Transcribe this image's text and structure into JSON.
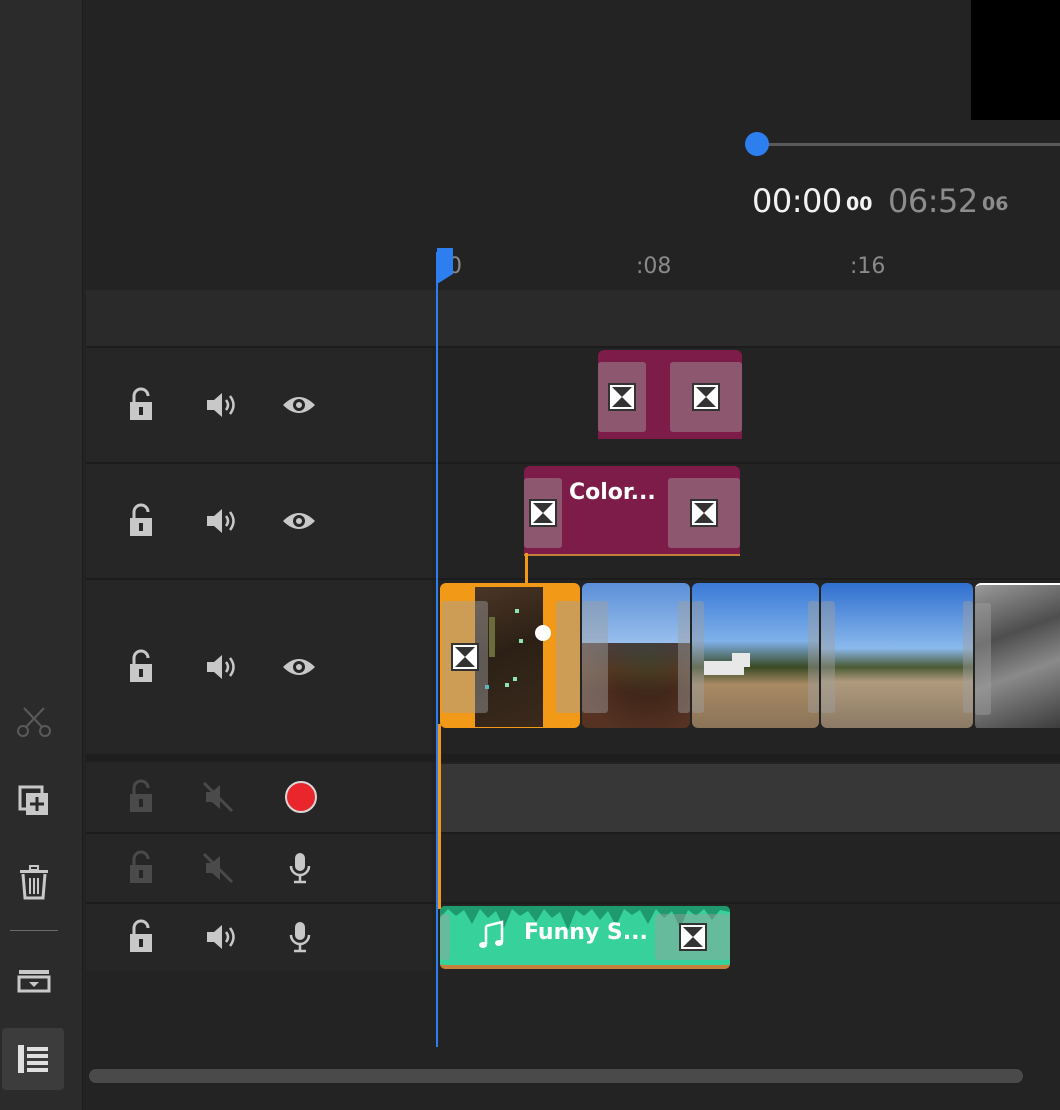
{
  "timecode": {
    "current": "00:00",
    "current_frames": "00",
    "duration": "06:52",
    "duration_frames": "06"
  },
  "ruler": {
    "labels": [
      "0",
      ":08",
      ":16"
    ]
  },
  "clips": {
    "title_clip_label": "Color...",
    "audio_clip_label": "Funny S..."
  },
  "colors": {
    "accent": "#2d7ff0",
    "selection": "#f29a18",
    "title_clip": "#7e1c49",
    "audio_clip": "#37d29b",
    "record": "#e8262b"
  },
  "icons": {
    "rail": [
      "scissors-icon",
      "add-copy-icon",
      "trash-icon",
      "track-size-icon",
      "list-view-icon"
    ],
    "track": [
      "lock-open-icon",
      "speaker-icon",
      "eye-icon",
      "speaker-muted-icon",
      "record-icon",
      "microphone-icon",
      "transition-icon",
      "music-note-icon"
    ]
  }
}
